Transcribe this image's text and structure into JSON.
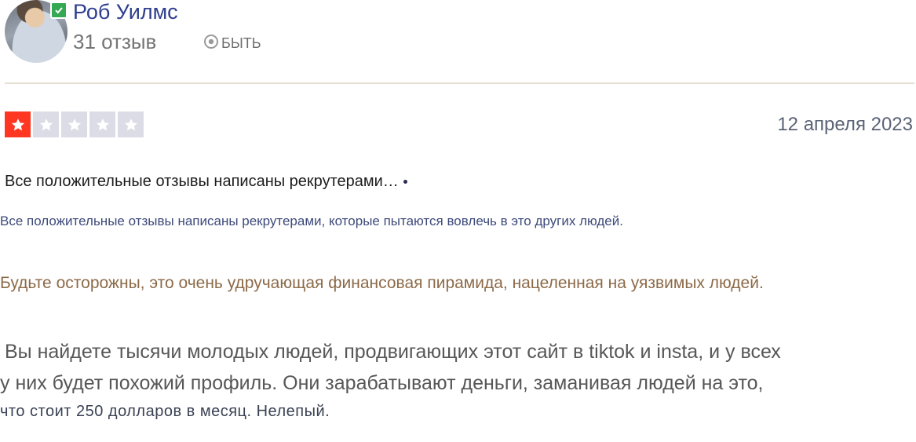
{
  "reviewer": {
    "name": "Роб Уилмс",
    "review_count": "31 отзыв",
    "location_code": "БЫТЬ"
  },
  "review": {
    "rating": 1,
    "rating_max": 5,
    "date": "12 апреля 2023",
    "title": "Все положительные отзывы написаны рекрутерами…",
    "paragraph_1": "Все положительные отзывы написаны рекрутерами, которые пытаются вовлечь в это других людей.",
    "paragraph_2": "Будьте осторожны, это очень удручающая финансовая пирамида, нацеленная на уязвимых людей.",
    "paragraph_3": {
      "line_1": "Вы найдете тысячи молодых людей, продвигающих этот сайт в tiktok и insta, и у всех",
      "line_2": "у них будет похожий профиль. Они зарабатывают деньги, заманивая людей на это,",
      "line_3": "что стоит 250 долларов в месяц. Нелепый."
    }
  },
  "colors": {
    "star_active": "#ff3722",
    "star_inactive": "#dcdce6",
    "verified_badge": "#34a853"
  },
  "icons": {
    "verified": "verified-check-icon",
    "location": "location-pin-icon",
    "star": "star-icon"
  }
}
